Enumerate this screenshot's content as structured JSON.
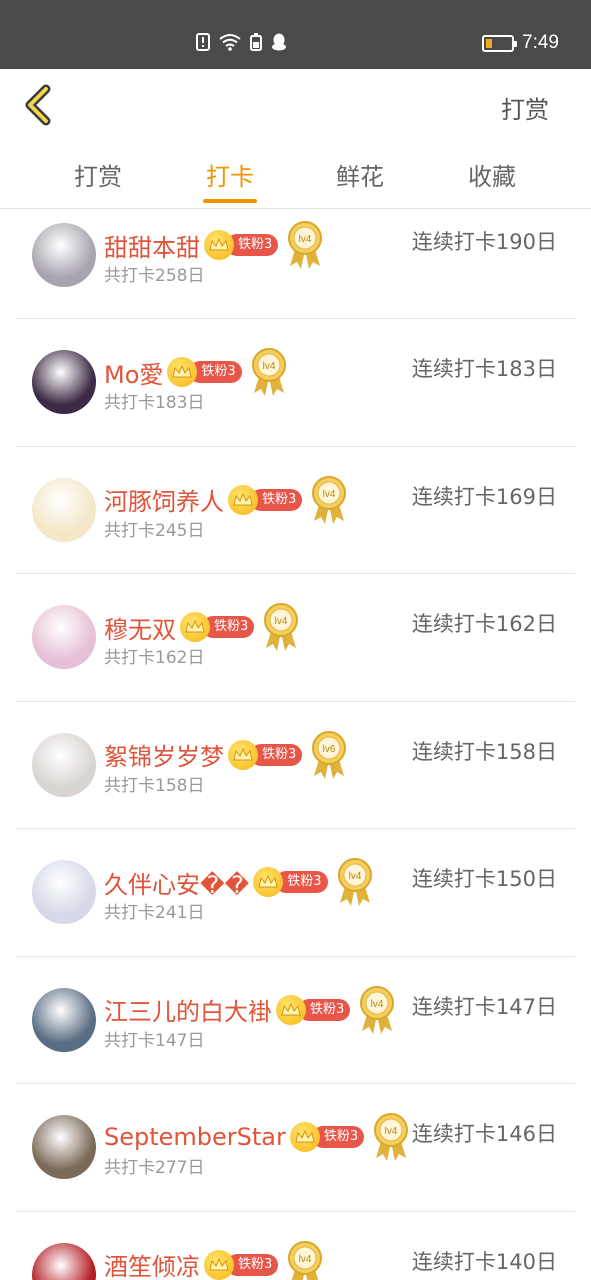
{
  "status_bar": {
    "time": "7:49"
  },
  "header": {
    "right_label": "打赏"
  },
  "tabs": [
    {
      "label": "打赏"
    },
    {
      "label": "打卡"
    },
    {
      "label": "鲜花"
    },
    {
      "label": "收藏"
    }
  ],
  "active_tab": "打卡",
  "fan_badge_label": "铁粉3",
  "rows": [
    {
      "name": "甜甜本甜",
      "total": "共打卡258日",
      "streak": "连续打卡190日",
      "level": "lv4",
      "avatar_color": "#a9a4b0"
    },
    {
      "name": "Mo愛",
      "total": "共打卡183日",
      "streak": "连续打卡183日",
      "level": "lv4",
      "avatar_color": "#3d2a45"
    },
    {
      "name": "河豚饲养人",
      "total": "共打卡245日",
      "streak": "连续打卡169日",
      "level": "lv4",
      "avatar_color": "#f3e7c8"
    },
    {
      "name": "穆无双",
      "total": "共打卡162日",
      "streak": "连续打卡162日",
      "level": "lv4",
      "avatar_color": "#e6c0d6"
    },
    {
      "name": "絮锦岁岁梦",
      "total": "共打卡158日",
      "streak": "连续打卡158日",
      "level": "lv6",
      "avatar_color": "#d9d4d2"
    },
    {
      "name": "久伴心安��",
      "total": "共打卡241日",
      "streak": "连续打卡150日",
      "level": "lv4",
      "avatar_color": "#d5d9e8"
    },
    {
      "name": "江三儿的白大褂",
      "total": "共打卡147日",
      "streak": "连续打卡147日",
      "level": "lv4",
      "avatar_color": "#5a6e83"
    },
    {
      "name": "SeptemberStar",
      "total": "共打卡277日",
      "streak": "连续打卡146日",
      "level": "lv4",
      "avatar_color": "#7b6a58"
    },
    {
      "name": "酒笙倾凉",
      "total": "",
      "streak": "连续打卡140日",
      "level": "lv4",
      "avatar_color": "#b31d25"
    }
  ]
}
